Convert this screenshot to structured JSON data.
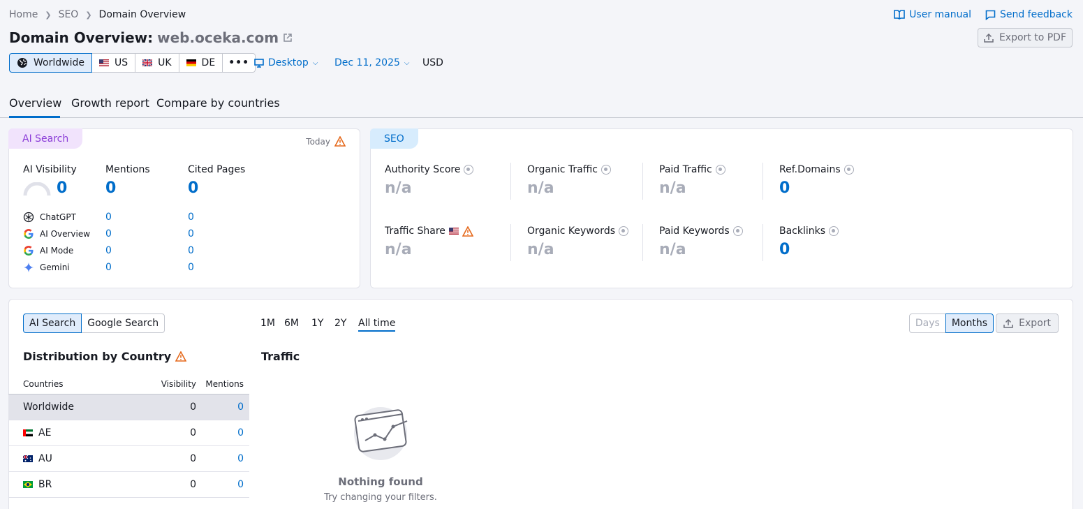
{
  "breadcrumb": [
    "Home",
    "SEO",
    "Domain Overview"
  ],
  "header": {
    "title_prefix": "Domain Overview:",
    "domain": "web.oceka.com",
    "user_manual": "User manual",
    "send_feedback": "Send feedback",
    "export_pdf": "Export to PDF"
  },
  "databases": [
    {
      "label": "Worldwide",
      "icon": "globe-icon",
      "selected": true
    },
    {
      "label": "US",
      "icon": "flag-us"
    },
    {
      "label": "UK",
      "icon": "flag-uk"
    },
    {
      "label": "DE",
      "icon": "flag-de"
    }
  ],
  "filters": {
    "device": "Desktop",
    "date": "Dec 11, 2025",
    "currency": "USD"
  },
  "tabs": [
    "Overview",
    "Growth report",
    "Compare by countries"
  ],
  "ai_card": {
    "pill": "AI Search",
    "today": "Today",
    "metrics": [
      {
        "label": "AI Visibility",
        "value": "0"
      },
      {
        "label": "Mentions",
        "value": "0"
      },
      {
        "label": "Cited Pages",
        "value": "0"
      }
    ],
    "sources": [
      {
        "name": "ChatGPT",
        "icon": "chatgpt-icon",
        "mentions": "0",
        "cited": "0"
      },
      {
        "name": "AI Overview",
        "icon": "google-icon",
        "mentions": "0",
        "cited": "0"
      },
      {
        "name": "AI Mode",
        "icon": "google-icon",
        "mentions": "0",
        "cited": "0"
      },
      {
        "name": "Gemini",
        "icon": "gemini-icon",
        "mentions": "0",
        "cited": "0"
      }
    ]
  },
  "seo_card": {
    "pill": "SEO",
    "metrics": [
      {
        "label": "Authority Score",
        "value": "n/a"
      },
      {
        "label": "Organic Traffic",
        "value": "n/a"
      },
      {
        "label": "Paid Traffic",
        "value": "n/a"
      },
      {
        "label": "Ref.Domains",
        "value": "0"
      },
      {
        "label": "Traffic Share",
        "value": "n/a"
      },
      {
        "label": "Organic Keywords",
        "value": "n/a"
      },
      {
        "label": "Paid Keywords",
        "value": "n/a"
      },
      {
        "label": "Backlinks",
        "value": "0"
      }
    ]
  },
  "bottom": {
    "search_toggle": [
      "AI Search",
      "Google Search"
    ],
    "periods": [
      "1M",
      "6M",
      "1Y",
      "2Y",
      "All time"
    ],
    "granularity": [
      "Days",
      "Months"
    ],
    "export": "Export",
    "distribution_title": "Distribution by Country",
    "traffic_title": "Traffic",
    "table_headers": [
      "Countries",
      "Visibility",
      "Mentions"
    ],
    "rows": [
      {
        "country": "Worldwide",
        "visibility": "0",
        "mentions": "0"
      },
      {
        "country": "AE",
        "visibility": "0",
        "mentions": "0"
      },
      {
        "country": "AU",
        "visibility": "0",
        "mentions": "0"
      },
      {
        "country": "BR",
        "visibility": "0",
        "mentions": "0"
      }
    ],
    "empty_title": "Nothing found",
    "empty_sub": "Try changing your filters."
  },
  "colors": {
    "accent": "#006dca",
    "ai_pill": "#f1e3fc",
    "seo_pill": "#d7ecfd",
    "warning": "#e5691c"
  }
}
